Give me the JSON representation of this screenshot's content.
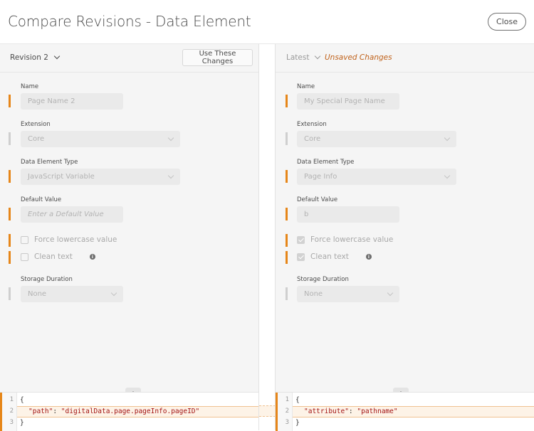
{
  "header": {
    "title": "Compare Revisions - Data Element",
    "close_label": "Close"
  },
  "left": {
    "revision_label": "Revision 2",
    "use_changes_label": "Use These Changes",
    "fields": {
      "name": {
        "label": "Name",
        "value": "Page Name 2",
        "changed": true
      },
      "extension": {
        "label": "Extension",
        "value": "Core",
        "changed": false
      },
      "type": {
        "label": "Data Element Type",
        "value": "JavaScript Variable",
        "changed": true
      },
      "default_value": {
        "label": "Default Value",
        "placeholder": "Enter a Default Value",
        "changed": true
      },
      "force_lowercase": {
        "label": "Force lowercase value",
        "checked": false,
        "changed": true
      },
      "clean_text": {
        "label": "Clean text",
        "checked": false,
        "changed": true
      },
      "storage": {
        "label": "Storage Duration",
        "value": "None",
        "changed": false
      }
    },
    "code": {
      "lines": [
        "1",
        "2",
        "3"
      ],
      "line1": "{",
      "key": "\"path\"",
      "sep": ": ",
      "val": "\"digitalData.page.pageInfo.pageID\"",
      "line3": "}"
    }
  },
  "right": {
    "revision_label": "Latest",
    "status": "Unsaved Changes",
    "fields": {
      "name": {
        "label": "Name",
        "value": "My Special Page Name",
        "changed": true
      },
      "extension": {
        "label": "Extension",
        "value": "Core",
        "changed": false
      },
      "type": {
        "label": "Data Element Type",
        "value": "Page Info",
        "changed": true
      },
      "default_value": {
        "label": "Default Value",
        "value": "b",
        "changed": true
      },
      "force_lowercase": {
        "label": "Force lowercase value",
        "checked": true,
        "changed": true
      },
      "clean_text": {
        "label": "Clean text",
        "checked": true,
        "changed": true
      },
      "storage": {
        "label": "Storage Duration",
        "value": "None",
        "changed": false
      }
    },
    "code": {
      "lines": [
        "1",
        "2",
        "3"
      ],
      "line1": "{",
      "key": "\"attribute\"",
      "sep": ": ",
      "val": "\"pathname\"",
      "line3": "}"
    }
  },
  "icons": {
    "info": "i"
  },
  "colors": {
    "accent_orange": "#e68619",
    "unsaved_text": "#c0621b",
    "string": "#a31515"
  }
}
